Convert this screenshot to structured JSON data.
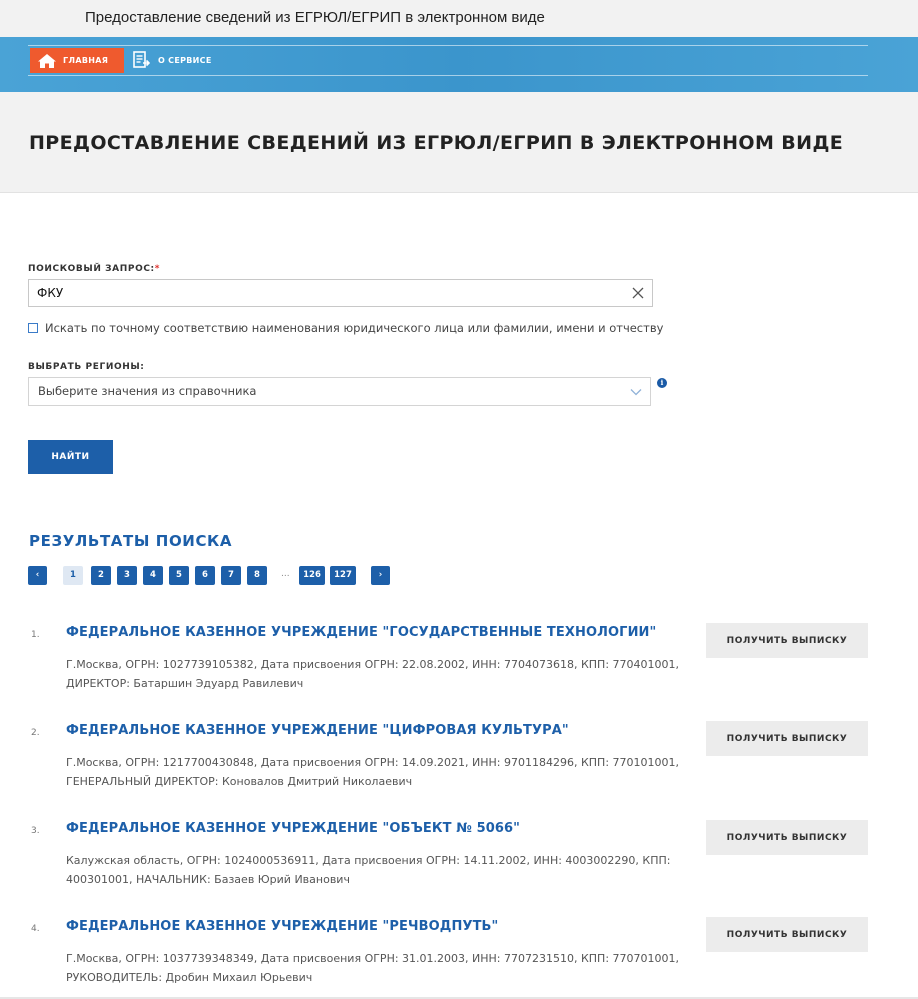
{
  "window": {
    "title": "Предоставление сведений из ЕГРЮЛ/ЕГРИП в электронном виде"
  },
  "nav": {
    "home_label": "ГЛАВНАЯ",
    "about_label": "О СЕРВИСЕ"
  },
  "header": {
    "title": "ПРЕДОСТАВЛЕНИЕ СВЕДЕНИЙ ИЗ ЕГРЮЛ/ЕГРИП В ЭЛЕКТРОННОМ ВИДЕ"
  },
  "search": {
    "label": "ПОИСКОВЫЙ ЗАПРОС:",
    "required_mark": "*",
    "value": "ФКУ",
    "exact_match_label": "Искать по точному соответствию наименования юридического лица или фамилии, имени и отчеству",
    "exact_match_checked": false
  },
  "regions": {
    "label": "ВЫБРАТЬ РЕГИОНЫ:",
    "placeholder": "Выберите значения из справочника",
    "info_glyph": "i"
  },
  "find_button": {
    "label": "НАЙТИ"
  },
  "results": {
    "title": "РЕЗУЛЬТАТЫ ПОИСКА",
    "pagination": {
      "prev": "‹",
      "next": "›",
      "pages": [
        "1",
        "2",
        "3",
        "4",
        "5",
        "6",
        "7",
        "8"
      ],
      "ellipsis": "...",
      "last_pages": [
        "126",
        "127"
      ],
      "active_page": "1"
    },
    "items": [
      {
        "num": "1.",
        "name": "ФЕДЕРАЛЬНОЕ КАЗЕННОЕ УЧРЕЖДЕНИЕ \"ГОСУДАРСТВЕННЫЕ ТЕХНОЛОГИИ\"",
        "details": "Г.Москва, ОГРН: 1027739105382, Дата присвоения ОГРН: 22.08.2002, ИНН: 7704073618, КПП: 770401001, ДИРЕКТОР: Батаршин Эдуард Равилевич",
        "button": "ПОЛУЧИТЬ ВЫПИСКУ"
      },
      {
        "num": "2.",
        "name": "ФЕДЕРАЛЬНОЕ КАЗЕННОЕ УЧРЕЖДЕНИЕ \"ЦИФРОВАЯ КУЛЬТУРА\"",
        "details": "Г.Москва, ОГРН: 1217700430848, Дата присвоения ОГРН: 14.09.2021, ИНН: 9701184296, КПП: 770101001, ГЕНЕРАЛЬНЫЙ ДИРЕКТОР: Коновалов Дмитрий Николаевич",
        "button": "ПОЛУЧИТЬ ВЫПИСКУ"
      },
      {
        "num": "3.",
        "name": "ФЕДЕРАЛЬНОЕ КАЗЕННОЕ УЧРЕЖДЕНИЕ \"ОБЪЕКТ № 5066\"",
        "details": "Калужская область, ОГРН: 1024000536911, Дата присвоения ОГРН: 14.11.2002, ИНН: 4003002290, КПП: 400301001, НАЧАЛЬНИК: Базаев Юрий Иванович",
        "button": "ПОЛУЧИТЬ ВЫПИСКУ"
      },
      {
        "num": "4.",
        "name": "ФЕДЕРАЛЬНОЕ КАЗЕННОЕ УЧРЕЖДЕНИЕ \"РЕЧВОДПУТЬ\"",
        "details": "Г.Москва, ОГРН: 1037739348349, Дата присвоения ОГРН: 31.01.2003, ИНН: 7707231510, КПП: 770701001, РУКОВОДИТЕЛЬ: Дробин Михаил Юрьевич",
        "button": "ПОЛУЧИТЬ ВЫПИСКУ"
      }
    ]
  },
  "colors": {
    "brand_blue": "#1d5fa9",
    "nav_blue": "#3b95cc",
    "home_orange": "#ef5a2e",
    "required_red": "#e0332f"
  }
}
